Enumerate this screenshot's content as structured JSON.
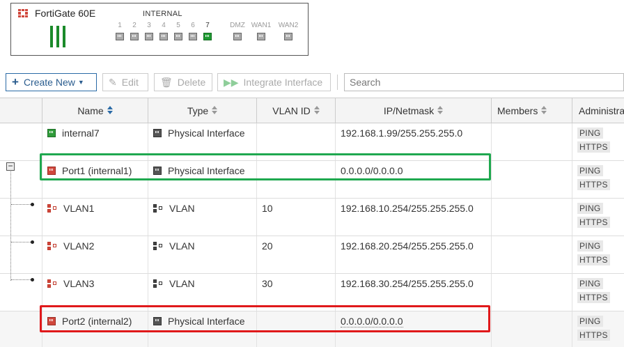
{
  "device": {
    "name": "FortiGate 60E",
    "internal_label": "INTERNAL",
    "ports": [
      {
        "label": "1",
        "active": false
      },
      {
        "label": "2",
        "active": false
      },
      {
        "label": "3",
        "active": false
      },
      {
        "label": "4",
        "active": false
      },
      {
        "label": "5",
        "active": false
      },
      {
        "label": "6",
        "active": false
      },
      {
        "label": "7",
        "active": true
      },
      {
        "label": "DMZ",
        "active": false
      },
      {
        "label": "WAN1",
        "active": false
      },
      {
        "label": "WAN2",
        "active": false
      }
    ]
  },
  "toolbar": {
    "create_new": "Create New",
    "edit": "Edit",
    "delete": "Delete",
    "integrate": "Integrate Interface",
    "search_placeholder": "Search"
  },
  "columns": {
    "name": "Name",
    "type": "Type",
    "vlan_id": "VLAN ID",
    "ip": "IP/Netmask",
    "members": "Members",
    "admin": "Administrative Access"
  },
  "rows": [
    {
      "name": "internal7",
      "type": "Physical Interface",
      "vlan_id": "",
      "ip": "192.168.1.99/255.255.255.0",
      "access": [
        "PING",
        "HTTPS"
      ],
      "icon": "interface-green-icon"
    },
    {
      "name": "Port1 (internal1)",
      "type": "Physical Interface",
      "vlan_id": "",
      "ip": "0.0.0.0/0.0.0.0",
      "access": [
        "PING",
        "HTTPS"
      ],
      "icon": "interface-red-icon"
    },
    {
      "name": "VLAN1",
      "type": "VLAN",
      "vlan_id": "10",
      "ip": "192.168.10.254/255.255.255.0",
      "access": [
        "PING",
        "HTTPS"
      ],
      "icon": "vlan-red-icon"
    },
    {
      "name": "VLAN2",
      "type": "VLAN",
      "vlan_id": "20",
      "ip": "192.168.20.254/255.255.255.0",
      "access": [
        "PING",
        "HTTPS"
      ],
      "icon": "vlan-red-icon"
    },
    {
      "name": "VLAN3",
      "type": "VLAN",
      "vlan_id": "30",
      "ip": "192.168.30.254/255.255.255.0",
      "access": [
        "PING",
        "HTTPS"
      ],
      "icon": "vlan-red-icon"
    },
    {
      "name": "Port2 (internal2)",
      "type": "Physical Interface",
      "vlan_id": "",
      "ip": "0.0.0.0/0.0.0.0",
      "access": [
        "PING",
        "HTTPS"
      ],
      "icon": "interface-red-icon"
    }
  ],
  "colors": {
    "accent": "#2a6aa6",
    "highlight_green": "#1fa84f",
    "highlight_red": "#e0191b",
    "port_active": "#1f9a32"
  }
}
